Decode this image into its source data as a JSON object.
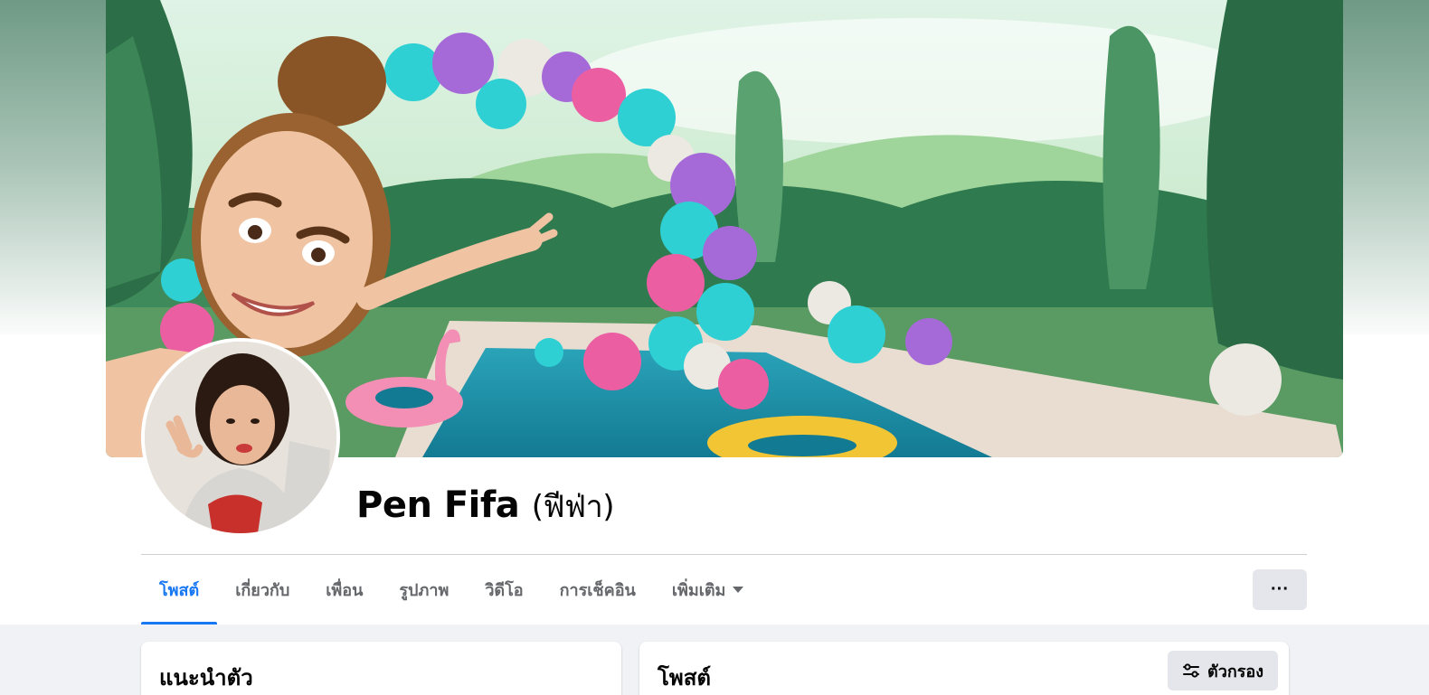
{
  "profile": {
    "name": "Pen Fifa",
    "alternate_name": "(ฟีฟ่า)"
  },
  "cover_photo": {
    "label": "cover-photo"
  },
  "profile_picture": {
    "label": "profile-picture"
  },
  "tabs": [
    {
      "label": "โพสต์",
      "active": true
    },
    {
      "label": "เกี่ยวกับ",
      "active": false
    },
    {
      "label": "เพื่อน",
      "active": false
    },
    {
      "label": "รูปภาพ",
      "active": false
    },
    {
      "label": "วิดีโอ",
      "active": false
    },
    {
      "label": "การเช็คอิน",
      "active": false
    },
    {
      "label": "เพิ่มเติม",
      "active": false
    }
  ],
  "more_button": {
    "label": "···"
  },
  "intro_card": {
    "title": "แนะนำตัว"
  },
  "posts_card": {
    "title": "โพสต์",
    "filter_label": "ตัวกรอง"
  },
  "colors": {
    "accent": "#1877f2",
    "tab_inactive": "#65676b",
    "button_bg": "#e4e6eb",
    "page_bg": "#f0f2f5"
  },
  "icons": [
    "dots-more-icon",
    "filter-sliders-icon",
    "caret-down-icon"
  ]
}
